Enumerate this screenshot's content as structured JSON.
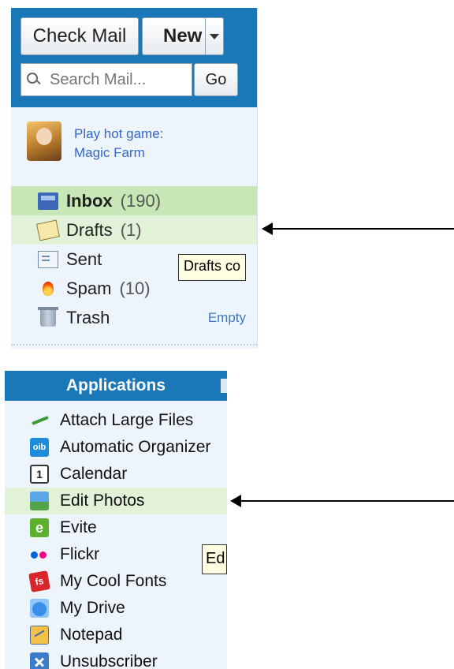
{
  "mail": {
    "check_mail_label": "Check Mail",
    "new_label": "New",
    "search": {
      "placeholder": "Search Mail...",
      "go_label": "Go"
    },
    "promo": {
      "line1": "Play hot game:",
      "line2": "Magic Farm"
    },
    "folders": [
      {
        "name": "Inbox",
        "count": "(190)",
        "icon": "inbox-icon"
      },
      {
        "name": "Drafts",
        "count": "(1)",
        "icon": "drafts-icon"
      },
      {
        "name": "Sent",
        "count": "",
        "icon": "sent-icon"
      },
      {
        "name": "Spam",
        "count": "(10)",
        "icon": "spam-icon"
      },
      {
        "name": "Trash",
        "count": "",
        "icon": "trash-icon"
      }
    ],
    "trash_empty_label": "Empty",
    "drafts_tooltip": "Drafts co",
    "highlight_colors": {
      "inbox": "#c7e7b7",
      "drafts": "#e2f2d9"
    }
  },
  "applications": {
    "header": "Applications",
    "items": [
      {
        "label": "Attach Large Files",
        "icon": "paper-plane-icon"
      },
      {
        "label": "Automatic Organizer",
        "icon": "oib-icon",
        "icon_text": "oib"
      },
      {
        "label": "Calendar",
        "icon": "calendar-icon",
        "icon_text": "1"
      },
      {
        "label": "Edit Photos",
        "icon": "photo-icon"
      },
      {
        "label": "Evite",
        "icon": "evite-icon",
        "icon_text": "e"
      },
      {
        "label": "Flickr",
        "icon": "flickr-icon"
      },
      {
        "label": "My Cool Fonts",
        "icon": "fonts-icon",
        "icon_text": "fs"
      },
      {
        "label": "My Drive",
        "icon": "drive-icon"
      },
      {
        "label": "Notepad",
        "icon": "notepad-icon"
      },
      {
        "label": "Unsubscriber",
        "icon": "unsubscriber-icon"
      }
    ],
    "tooltip": "Ed"
  },
  "colors": {
    "header_blue": "#1a77b8",
    "panel_bg": "#eef4fb",
    "link_blue": "#3366cc"
  }
}
